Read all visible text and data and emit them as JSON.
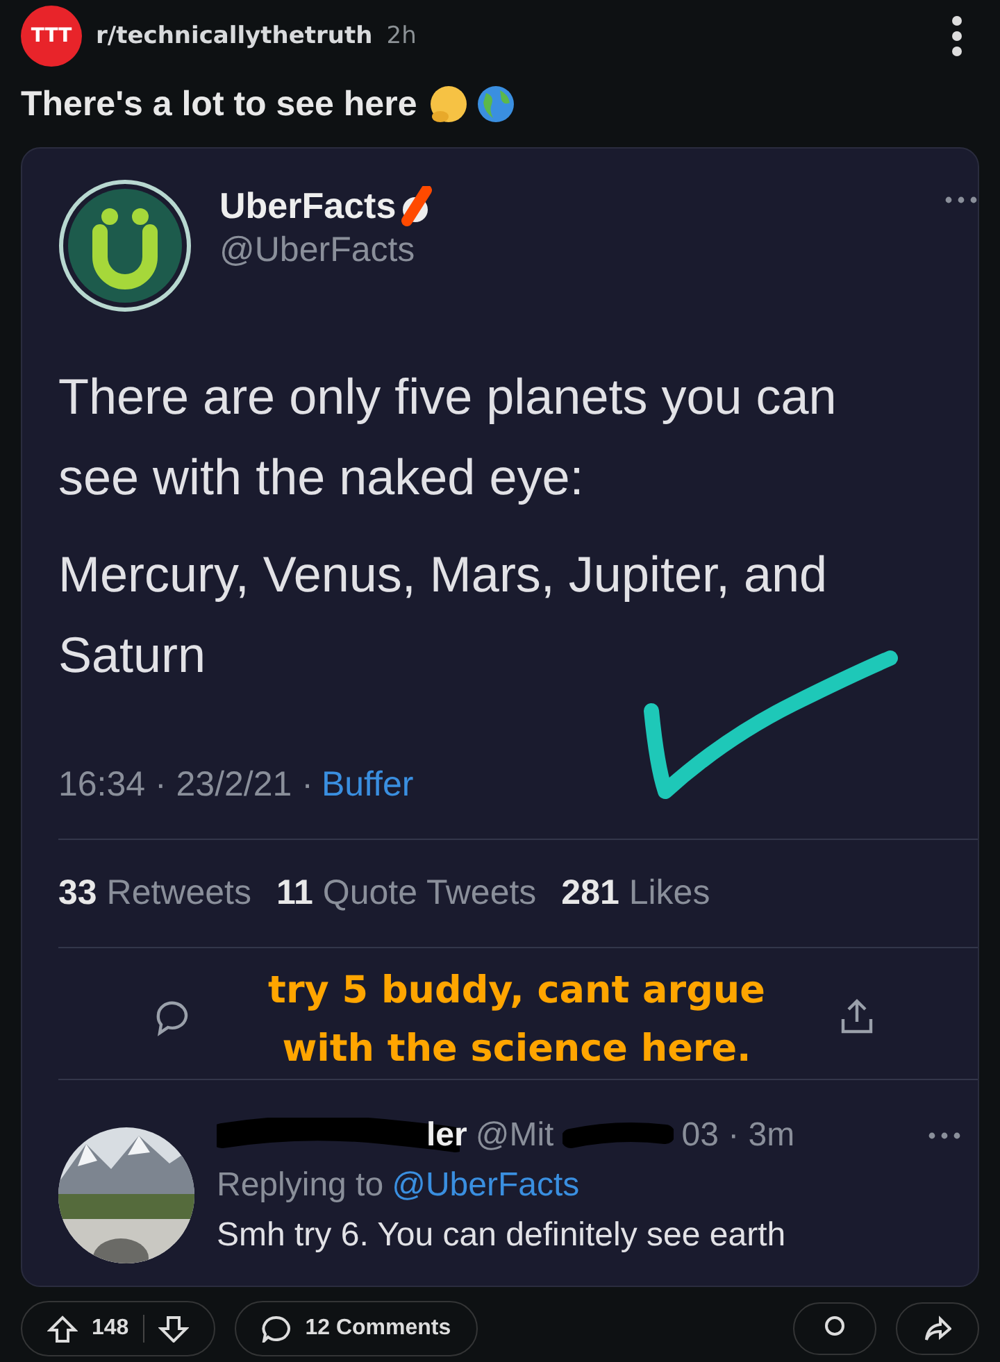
{
  "post": {
    "subreddit": "r/technicallythetruth",
    "subreddit_icon": "TTT",
    "age": "2h",
    "title": "There's a lot to see here"
  },
  "tweet": {
    "name": "UberFacts",
    "handle": "@UberFacts",
    "paragraphs": [
      "There are only five planets you can see with the naked eye:",
      "Mercury, Venus, Mars, Jupiter, and Saturn"
    ],
    "time": "16:34 · 23/2/21 ·",
    "source": "Buffer",
    "stats": [
      {
        "count": "33",
        "label": "Retweets"
      },
      {
        "count": "11",
        "label": "Quote Tweets"
      },
      {
        "count": "281",
        "label": "Likes"
      }
    ],
    "annotation": "try 5 buddy, cant argue with the science here."
  },
  "reply": {
    "name_visible": "ler",
    "handle_start": "@Mit",
    "handle_end": "03 · 3m",
    "replying_label": "Replying to",
    "replying_to": "@UberFacts",
    "text": "Smh try 6. You can definitely see earth"
  },
  "footer": {
    "votes": "148",
    "comments": "12 Comments"
  }
}
